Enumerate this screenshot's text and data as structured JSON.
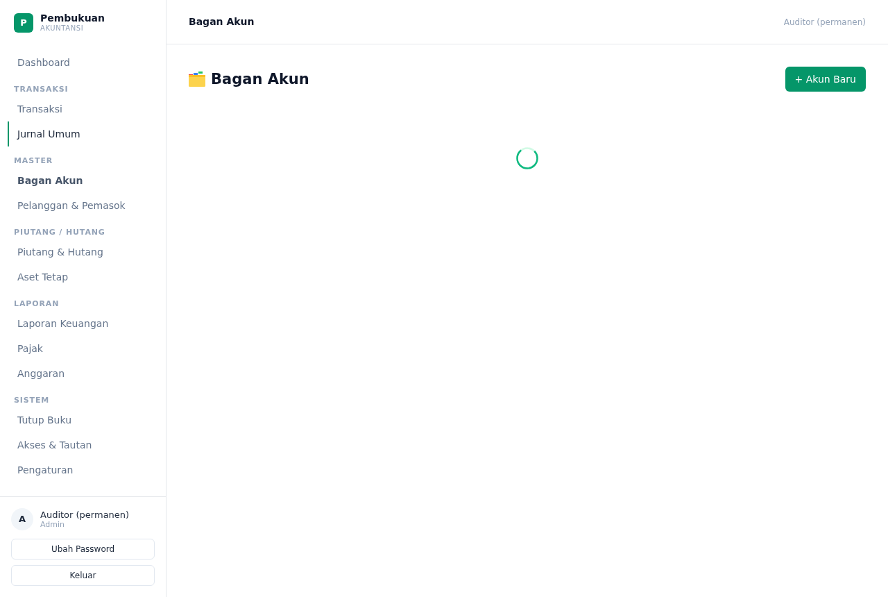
{
  "sidebar": {
    "brand": {
      "logo_letter": "P",
      "title": "Pembukuan",
      "subtitle": "AKUNTANSI"
    },
    "nav": [
      {
        "kind": "item",
        "label": "Dashboard",
        "selected": false,
        "hovered": false
      },
      {
        "kind": "section",
        "label": "TRANSAKSI"
      },
      {
        "kind": "item",
        "label": "Transaksi",
        "selected": false,
        "hovered": false
      },
      {
        "kind": "item",
        "label": "Jurnal Umum",
        "selected": false,
        "hovered": true
      },
      {
        "kind": "section",
        "label": "MASTER"
      },
      {
        "kind": "item",
        "label": "Bagan Akun",
        "selected": true,
        "hovered": false
      },
      {
        "kind": "item",
        "label": "Pelanggan & Pemasok",
        "selected": false,
        "hovered": false
      },
      {
        "kind": "section",
        "label": "PIUTANG / HUTANG"
      },
      {
        "kind": "item",
        "label": "Piutang & Hutang",
        "selected": false,
        "hovered": false
      },
      {
        "kind": "item",
        "label": "Aset Tetap",
        "selected": false,
        "hovered": false
      },
      {
        "kind": "section",
        "label": "LAPORAN"
      },
      {
        "kind": "item",
        "label": "Laporan Keuangan",
        "selected": false,
        "hovered": false
      },
      {
        "kind": "item",
        "label": "Pajak",
        "selected": false,
        "hovered": false
      },
      {
        "kind": "item",
        "label": "Anggaran",
        "selected": false,
        "hovered": false
      },
      {
        "kind": "section",
        "label": "SISTEM"
      },
      {
        "kind": "item",
        "label": "Tutup Buku",
        "selected": false,
        "hovered": false
      },
      {
        "kind": "item",
        "label": "Akses & Tautan",
        "selected": false,
        "hovered": false
      },
      {
        "kind": "item",
        "label": "Pengaturan",
        "selected": false,
        "hovered": false
      }
    ],
    "user": {
      "avatar_letter": "A",
      "name": "Auditor (permanen)",
      "role": "Admin"
    },
    "buttons": [
      "Ubah Password",
      "Keluar"
    ]
  },
  "topbar": {
    "title": "Bagan Akun",
    "user": "Auditor (permanen)"
  },
  "content": {
    "title": "Bagan Akun",
    "primary_button": "+ Akun Baru",
    "loading": true
  }
}
